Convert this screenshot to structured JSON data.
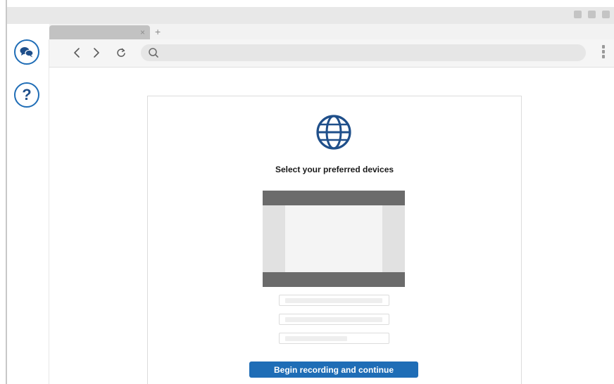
{
  "browser": {
    "tab": {
      "close_glyph": "×",
      "title": ""
    },
    "new_tab_glyph": "+",
    "nav": {
      "back_icon": "chevron-left-icon",
      "forward_icon": "chevron-right-icon",
      "reload_icon": "reload-icon",
      "search_icon": "search-icon",
      "menu_icon": "kebab-menu-icon"
    },
    "address_bar": {
      "value": "",
      "placeholder": ""
    }
  },
  "sidebar": {
    "chat_icon": "chat-bubbles-icon",
    "help_glyph": "?"
  },
  "dialog": {
    "icon": "globe-icon",
    "heading": "Select your preferred devices",
    "selects": [
      {
        "name": "device-select-1",
        "value": ""
      },
      {
        "name": "device-select-2",
        "value": ""
      },
      {
        "name": "device-select-3",
        "value": ""
      }
    ],
    "cta_label": "Begin recording and continue"
  },
  "colors": {
    "accent": "#1f6db6",
    "preview_bar": "#6b6b6b"
  }
}
